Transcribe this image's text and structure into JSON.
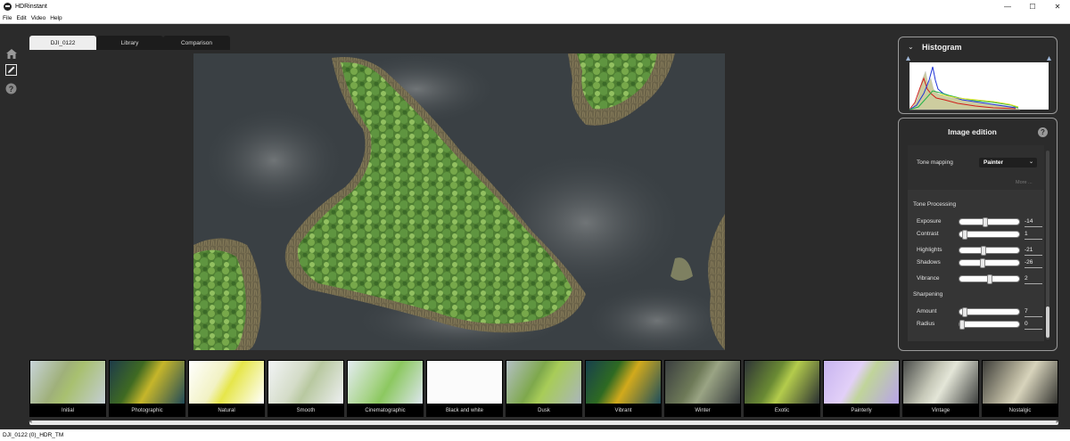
{
  "window": {
    "title": "HDRinstant",
    "controls": [
      "—",
      "☐",
      "✕"
    ]
  },
  "menu": [
    "File",
    "Edit",
    "Video",
    "Help"
  ],
  "sidebar": {
    "icons": [
      "home-icon",
      "edit-icon",
      "help-icon"
    ]
  },
  "tabs": [
    {
      "label": "DJI_0122",
      "active": true
    },
    {
      "label": "Library",
      "active": false
    },
    {
      "label": "Comparison",
      "active": false
    }
  ],
  "histogram": {
    "title": "Histogram",
    "collapse_icon": "chevron-down-icon"
  },
  "edition": {
    "title": "Image edition",
    "help": "?",
    "tone_mapping_label": "Tone mapping",
    "tone_mapping_value": "Painter",
    "more_label": "More ...",
    "tone_processing_label": "Tone Processing",
    "sliders": [
      {
        "label": "Exposure",
        "value": "-14",
        "level": 0.43
      },
      {
        "label": "Contrast",
        "value": "1",
        "level": 0.05
      },
      {
        "label": "Highlights",
        "value": "-21",
        "level": 0.4
      },
      {
        "label": "Shadows",
        "value": "-26",
        "level": 0.37
      },
      {
        "label": "Vibrance",
        "value": "2",
        "level": 0.51
      }
    ],
    "sharpening_label": "Sharpening",
    "sharpening_sliders": [
      {
        "label": "Amount",
        "value": "7",
        "level": 0.05
      },
      {
        "label": "Radius",
        "value": "0",
        "level": 0.0
      }
    ]
  },
  "presets": [
    "Initial",
    "Photographic",
    "Natural",
    "Smooth",
    "Cinematographic",
    "Black and white",
    "Dusk",
    "Vibrant",
    "Winter",
    "Exotic",
    "Painterly",
    "Vintage",
    "Nostalgic"
  ],
  "status": "DJI_0122 (0)_HDR_TM"
}
